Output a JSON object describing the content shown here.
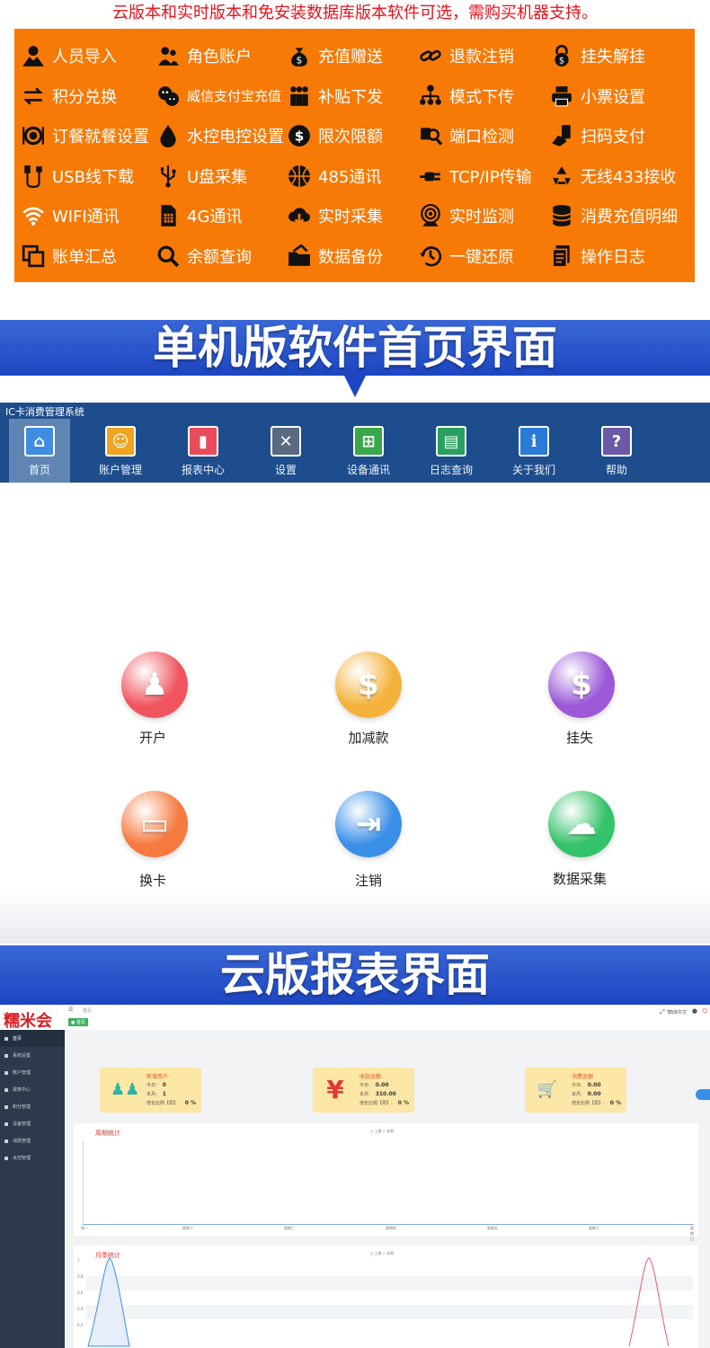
{
  "header_text": "云版本和实时版本和免安装数据库版本软件可选，需购买机器支持。",
  "features": [
    [
      {
        "icon": "person-icon",
        "label": "人员导入"
      },
      {
        "icon": "users-icon",
        "label": "角色账户"
      },
      {
        "icon": "money-bag-icon",
        "label": "充值赠送"
      },
      {
        "icon": "link-icon",
        "label": "退款注销"
      },
      {
        "icon": "lock-icon",
        "label": "挂失解挂"
      }
    ],
    [
      {
        "icon": "exchange-icon",
        "label": "积分兑换"
      },
      {
        "icon": "wechat-alipay-icon",
        "label": "威信支付宝充值",
        "small": true
      },
      {
        "icon": "group-icon",
        "label": "补贴下发"
      },
      {
        "icon": "tree-icon",
        "label": "模式下传"
      },
      {
        "icon": "printer-icon",
        "label": "小票设置"
      }
    ],
    [
      {
        "icon": "dish-icon",
        "label": "订餐就餐设置"
      },
      {
        "icon": "drop-icon",
        "label": "水控电控设置"
      },
      {
        "icon": "dollar-icon",
        "label": "限次限额"
      },
      {
        "icon": "search-port-icon",
        "label": "端口检测"
      },
      {
        "icon": "hand-phone-icon",
        "label": "扫码支付"
      }
    ],
    [
      {
        "icon": "usb-cable-icon",
        "label": "USB线下载"
      },
      {
        "icon": "usb-icon",
        "label": "U盘采集"
      },
      {
        "icon": "basketball-icon",
        "label": "485通讯"
      },
      {
        "icon": "plug-icon",
        "label": "TCP/IP传输"
      },
      {
        "icon": "recycle-icon",
        "label": "无线433接收"
      }
    ],
    [
      {
        "icon": "wifi-icon",
        "label": "WIFI通讯"
      },
      {
        "icon": "sim-icon",
        "label": "4G通讯"
      },
      {
        "icon": "cloud-download-icon",
        "label": "实时采集"
      },
      {
        "icon": "camera-icon",
        "label": "实时监测"
      },
      {
        "icon": "database-icon",
        "label": "消费充值明细"
      }
    ],
    [
      {
        "icon": "copy-icon",
        "label": "账单汇总"
      },
      {
        "icon": "search-icon",
        "label": "余额查询"
      },
      {
        "icon": "folder-icon",
        "label": "数据备份"
      },
      {
        "icon": "history-icon",
        "label": "一键还原"
      },
      {
        "icon": "doc-icon",
        "label": "操作日志"
      }
    ]
  ],
  "banner1": "单机版软件首页界面",
  "banner2": "云版报表界面",
  "desktop": {
    "title": "IC卡消费管理系统",
    "nav": [
      {
        "name": "home",
        "label": "首页",
        "color": "#3e8de0"
      },
      {
        "name": "account",
        "label": "账户管理",
        "color": "#f0a422"
      },
      {
        "name": "report",
        "label": "报表中心",
        "color": "#e84c5c"
      },
      {
        "name": "settings",
        "label": "设置",
        "color": "#5a6a80"
      },
      {
        "name": "device",
        "label": "设备通讯",
        "color": "#3aa84a"
      },
      {
        "name": "log",
        "label": "日志查询",
        "color": "#2aa060"
      },
      {
        "name": "about",
        "label": "关于我们",
        "color": "#2a7ad8"
      },
      {
        "name": "help",
        "label": "帮助",
        "color": "#6a5aa8"
      }
    ],
    "actions": [
      {
        "name": "open-account",
        "label": "开户",
        "color": "#f0555f"
      },
      {
        "name": "adjust-balance",
        "label": "加减款",
        "color": "#f4b23c"
      },
      {
        "name": "report-loss",
        "label": "挂失",
        "color": "#9b59d8"
      },
      {
        "name": "change-card",
        "label": "换卡",
        "color": "#f6793f"
      },
      {
        "name": "cancel",
        "label": "注销",
        "color": "#3a8fe8"
      },
      {
        "name": "data-collect",
        "label": "数据采集",
        "color": "#34c26a"
      }
    ]
  },
  "cloud": {
    "logo": "糯米会",
    "breadcrumb": "首页",
    "tab": "● 首页",
    "lang": "简体中文",
    "sidebar": [
      "首页",
      "系统设置",
      "账户管理",
      "报表中心",
      "积分管理",
      "设备管理",
      "消费管理",
      "水控管理"
    ],
    "cards": [
      {
        "title": "新增用户",
        "today": "0",
        "month": "1",
        "ratio": "0 %",
        "icon": "users-icon"
      },
      {
        "title": "收款金额",
        "today": "0.00",
        "month": "310.00",
        "ratio": "0 %",
        "icon": "yen-icon"
      },
      {
        "title": "消费金额",
        "today": "0.00",
        "month": "0.00",
        "ratio": "0 %",
        "icon": "cart-icon"
      }
    ],
    "card_labels": {
      "today": "今日:",
      "month": "本月:",
      "ratio": "增长比例【周】:"
    },
    "weekly_title": "周期统计",
    "monthly_title": "月季统计",
    "legend": [
      "上周",
      "本周"
    ],
    "weekdays": [
      "周一",
      "星期二",
      "星期三",
      "星期四",
      "星期五",
      "星期六",
      "星期日"
    ],
    "monthly_y": [
      "1",
      "0.8",
      "0.6",
      "0.4",
      "0.2"
    ]
  }
}
